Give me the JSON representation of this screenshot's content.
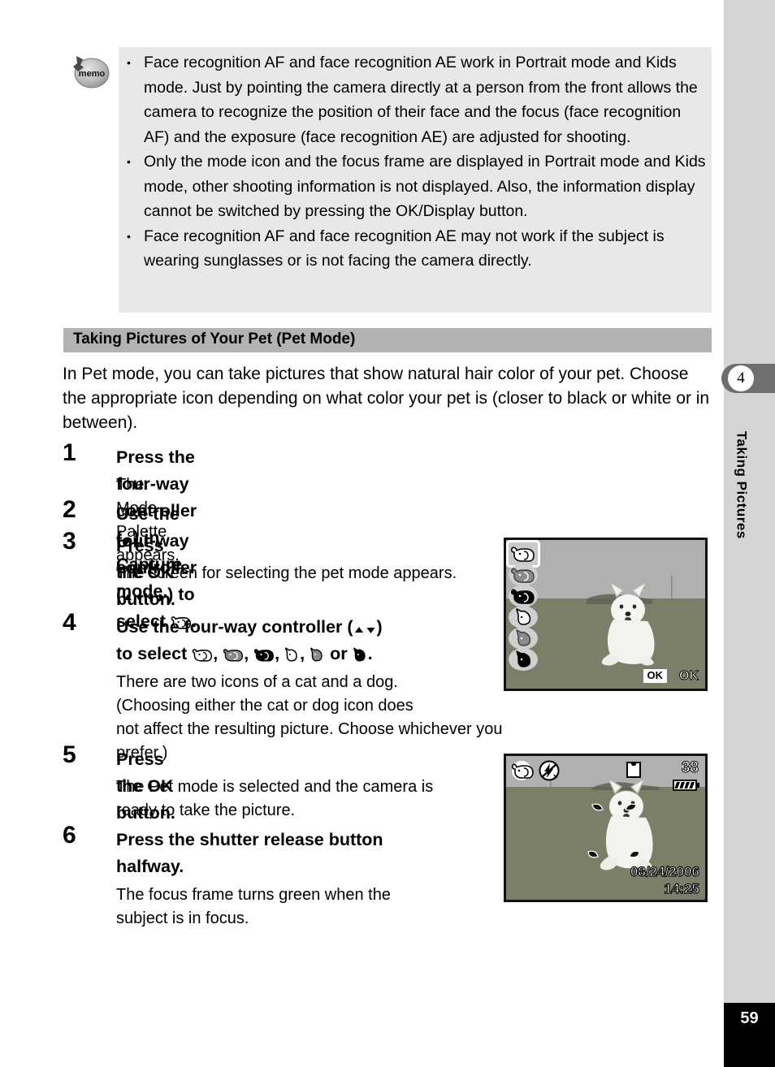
{
  "memo": {
    "icon_label": "memo",
    "items": [
      "Face recognition AF and face recognition AE work in Portrait mode and Kids mode. Just by pointing the camera directly at a person from the front allows the camera to recognize the position of their face and the focus (face recognition AF) and the exposure (face recognition AE) are adjusted for shooting.",
      "Only the mode icon and the focus frame are displayed in Portrait mode and Kids mode, other shooting information is not displayed. Also, the information display cannot be switched by pressing the OK/Display button.",
      "Face recognition AF and face recognition AE may not work if the subject is wearing sunglasses or is not facing the camera directly."
    ]
  },
  "section": {
    "title": "Taking Pictures of Your Pet (Pet Mode)",
    "intro": "In Pet mode, you can take pictures that show natural hair color of your pet. Choose the appropriate icon depending on what color your pet is (closer to black or white or in between)."
  },
  "steps": [
    {
      "number": "1",
      "head_a": "Press the four-way controller (",
      "head_b": ") in Capture mode.",
      "body": "The Mode Palette appears."
    },
    {
      "number": "2",
      "head_a": "Use the four-way controller (",
      "head_b": ") to select",
      "head_c": ".",
      "body": ""
    },
    {
      "number": "3",
      "head_a": "Press the OK button.",
      "body": "The screen for selecting the pet mode appears."
    },
    {
      "number": "4",
      "head_a": "Use the four-way controller (",
      "head_b": ")",
      "head_c": "to select",
      "head_d": "or",
      "head_e": ".",
      "body_line1": "There are two icons of a cat and a dog.",
      "body_line2": "(Choosing either the cat or dog icon does",
      "body_line3": "not affect the resulting picture. Choose whichever you prefer.)"
    },
    {
      "number": "5",
      "head_a": "Press the OK button.",
      "body_line1": "The Pet mode is selected and the camera is",
      "body_line2": "ready to take the picture."
    },
    {
      "number": "6",
      "head_a": "Press the shutter release button",
      "head_b": "halfway.",
      "body_line1": "The focus frame turns green when the",
      "body_line2": "subject is in focus."
    }
  ],
  "screens": {
    "pet_select": {
      "ok_box_label": "OK",
      "ok_glyph_label": "OK",
      "icons": [
        "pet-dog-white-icon",
        "pet-dog-gray-icon",
        "pet-dog-black-icon",
        "pet-cat-white-icon",
        "pet-cat-gray-icon",
        "pet-cat-black-icon"
      ],
      "selected_index": 0
    },
    "capture": {
      "shots_remaining": "38",
      "date": "08/24/2006",
      "time": "14:25",
      "icons": [
        "pet-mode-icon",
        "flash-off-icon",
        "sd-card-icon",
        "battery-icon"
      ]
    }
  },
  "sidebar": {
    "chapter_number": "4",
    "chapter_title": "Taking Pictures"
  },
  "footer": {
    "page_number": "59"
  }
}
